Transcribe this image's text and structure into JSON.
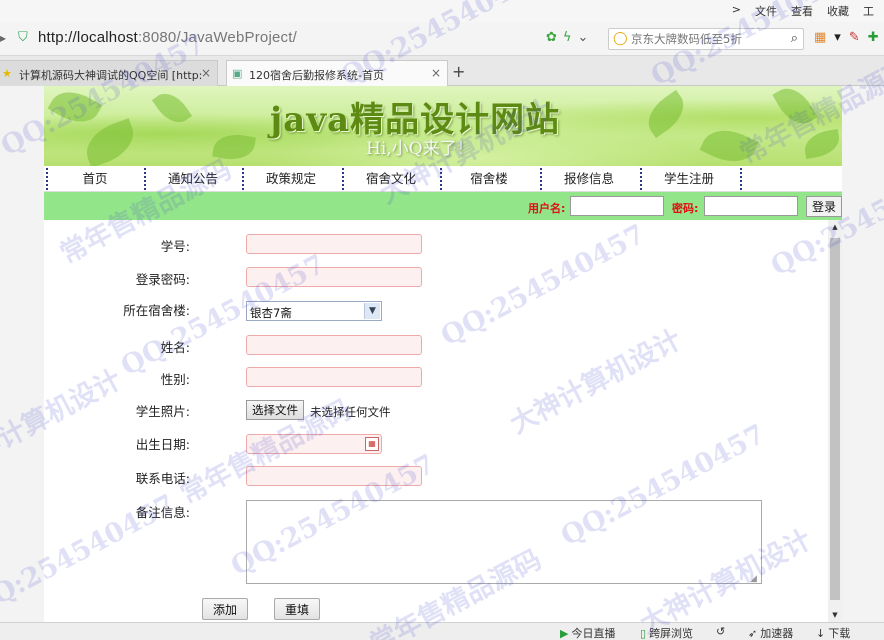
{
  "browser": {
    "menus": [
      "文件",
      "查看",
      "收藏",
      "工"
    ],
    "url_host": "http://localhost",
    "url_rest": ":8080/JavaWebProject/",
    "search_placeholder": "京东大牌数码低至5折",
    "tabs": [
      {
        "label": "计算机源码大神调试的QQ空间 [http:"
      },
      {
        "label": "120宿舍后勤报修系统-首页"
      }
    ],
    "new_tab": "+"
  },
  "banner": {
    "title": "java精品设计网站",
    "subtitle": "Hi,小Q来了！"
  },
  "nav": {
    "items": [
      "首页",
      "通知公告",
      "政策规定",
      "宿舍文化",
      "宿舍楼",
      "报修信息",
      "学生注册"
    ]
  },
  "login": {
    "username_label": "用户名:",
    "password_label": "密码:",
    "login_button": "登录"
  },
  "form": {
    "student_id_label": "学号:",
    "password_label": "登录密码:",
    "building_label": "所在宿舍楼:",
    "building_value": "银杏7斋",
    "name_label": "姓名:",
    "gender_label": "性别:",
    "photo_label": "学生照片:",
    "file_button": "选择文件",
    "file_status": "未选择任何文件",
    "birthdate_label": "出生日期:",
    "phone_label": "联系电话:",
    "notes_label": "备注信息:",
    "add_button": "添加",
    "reset_button": "重填"
  },
  "statusbar": {
    "items": [
      "今日直播",
      "跨屏浏览",
      "加速器",
      "下载"
    ]
  },
  "watermarks": [
    "QQ:254540457",
    "常年售精品源码",
    "大神计算机设计"
  ]
}
